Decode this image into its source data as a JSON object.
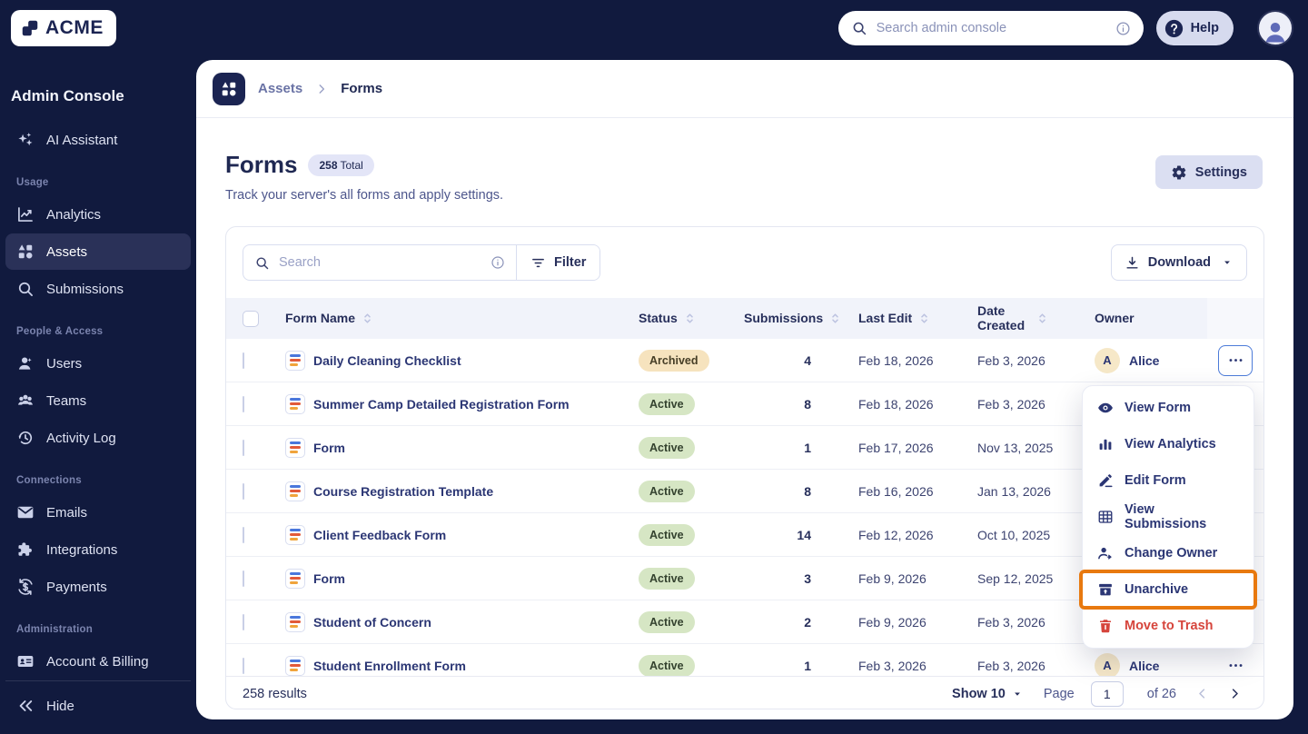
{
  "colors": {
    "navy": "#111A3E",
    "accent_orange": "#E8790F",
    "danger_red": "#D6453C",
    "focus_blue": "#4C7BD9",
    "active_badge": "#D6E6C4",
    "archived_badge": "#F6E3BE"
  },
  "topbar": {
    "logo_text": "ACME",
    "search_placeholder": "Search admin console",
    "help_label": "Help"
  },
  "sidebar": {
    "title": "Admin Console",
    "assistant": {
      "label": "AI Assistant",
      "icon": "sparkles-icon"
    },
    "sections": [
      {
        "label": "Usage",
        "items": [
          {
            "label": "Analytics",
            "icon": "analytics-icon",
            "active": false
          },
          {
            "label": "Assets",
            "icon": "assets-icon",
            "active": true
          },
          {
            "label": "Submissions",
            "icon": "search-icon",
            "active": false
          }
        ]
      },
      {
        "label": "People & Access",
        "items": [
          {
            "label": "Users",
            "icon": "user-icon",
            "active": false
          },
          {
            "label": "Teams",
            "icon": "team-icon",
            "active": false
          },
          {
            "label": "Activity Log",
            "icon": "history-icon",
            "active": false
          }
        ]
      },
      {
        "label": "Connections",
        "items": [
          {
            "label": "Emails",
            "icon": "mail-icon",
            "active": false
          },
          {
            "label": "Integrations",
            "icon": "puzzle-icon",
            "active": false
          },
          {
            "label": "Payments",
            "icon": "payments-icon",
            "active": false
          }
        ]
      },
      {
        "label": "Administration",
        "items": [
          {
            "label": "Account & Billing",
            "icon": "idcard-icon",
            "active": false
          }
        ]
      }
    ],
    "hide_label": "Hide"
  },
  "breadcrumb": {
    "parent": "Assets",
    "current": "Forms"
  },
  "page_header": {
    "title": "Forms",
    "badge_value": "258",
    "badge_suffix": "Total",
    "description": "Track your server's all forms and apply settings.",
    "settings_label": "Settings"
  },
  "toolbar": {
    "search_placeholder": "Search",
    "filter_label": "Filter",
    "download_label": "Download"
  },
  "table": {
    "columns": [
      {
        "label": "Form Name",
        "sortable": true
      },
      {
        "label": "Status",
        "sortable": true
      },
      {
        "label": "Submissions",
        "sortable": true
      },
      {
        "label": "Last Edit",
        "sortable": true
      },
      {
        "label": "Date Created",
        "sortable": true
      },
      {
        "label": "Owner",
        "sortable": false
      }
    ],
    "rows": [
      {
        "name": "Daily Cleaning Checklist",
        "status": "Archived",
        "submissions": "4",
        "last_edit": "Feb 18, 2026",
        "date_created": "Feb 3, 2026",
        "owner": {
          "initial": "A",
          "name": "Alice"
        },
        "more_focused": true
      },
      {
        "name": "Summer Camp Detailed Registration Form",
        "status": "Active",
        "submissions": "8",
        "last_edit": "Feb 18, 2026",
        "date_created": "Feb 3, 2026",
        "owner": null,
        "more_focused": false
      },
      {
        "name": "Form",
        "status": "Active",
        "submissions": "1",
        "last_edit": "Feb 17, 2026",
        "date_created": "Nov 13, 2025",
        "owner": null,
        "more_focused": false
      },
      {
        "name": "Course Registration Template",
        "status": "Active",
        "submissions": "8",
        "last_edit": "Feb 16, 2026",
        "date_created": "Jan 13, 2026",
        "owner": null,
        "more_focused": false
      },
      {
        "name": "Client Feedback Form",
        "status": "Active",
        "submissions": "14",
        "last_edit": "Feb 12, 2026",
        "date_created": "Oct 10, 2025",
        "owner": null,
        "more_focused": false
      },
      {
        "name": "Form",
        "status": "Active",
        "submissions": "3",
        "last_edit": "Feb 9, 2026",
        "date_created": "Sep 12, 2025",
        "owner": null,
        "more_focused": false
      },
      {
        "name": "Student of Concern",
        "status": "Active",
        "submissions": "2",
        "last_edit": "Feb 9, 2026",
        "date_created": "Feb 3, 2026",
        "owner": null,
        "more_focused": false
      },
      {
        "name": "Student Enrollment Form",
        "status": "Active",
        "submissions": "1",
        "last_edit": "Feb 3, 2026",
        "date_created": "Feb 3, 2026",
        "owner": {
          "initial": "A",
          "name": "Alice"
        },
        "more_focused": false
      }
    ]
  },
  "context_menu": {
    "items": [
      {
        "label": "View Form",
        "icon": "eye-icon",
        "annotated": false,
        "danger": false
      },
      {
        "label": "View Analytics",
        "icon": "bar-chart-icon",
        "annotated": false,
        "danger": false
      },
      {
        "label": "Edit Form",
        "icon": "pencil-icon",
        "annotated": false,
        "danger": false
      },
      {
        "label": "View Submissions",
        "icon": "table-icon",
        "annotated": false,
        "danger": false
      },
      {
        "label": "Change Owner",
        "icon": "change-owner-icon",
        "annotated": false,
        "danger": false
      },
      {
        "label": "Unarchive",
        "icon": "unarchive-icon",
        "annotated": true,
        "danger": false
      },
      {
        "label": "Move to Trash",
        "icon": "trash-icon",
        "annotated": false,
        "danger": true
      }
    ]
  },
  "pagination": {
    "results": "258 results",
    "show_label": "Show 10",
    "page_label": "Page",
    "page_value": "1",
    "of_label": "of 26"
  }
}
